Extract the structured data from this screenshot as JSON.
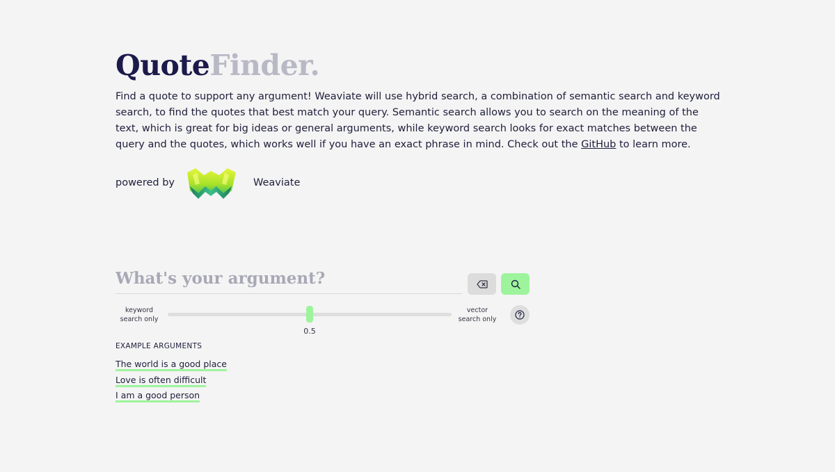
{
  "header": {
    "title_part1": "Quote",
    "title_part2": "Finder."
  },
  "description": {
    "text_before_link": "Find a quote to support any argument! Weaviate will use hybrid search, a combination of semantic search and keyword search, to find the quotes that best match your query. Semantic search allows you to search on the meaning of the text, which is great for big ideas or general arguments, while keyword search looks for exact matches between the query and the quotes, which works well if you have an exact phrase in mind. Check out the ",
    "link_text": "GitHub",
    "text_after_link": " to learn more."
  },
  "powered_by": {
    "label": "powered by",
    "name": "Weaviate",
    "logo_icon": "weaviate-logo"
  },
  "search": {
    "placeholder": "What's your argument?",
    "value": "",
    "clear_icon": "backspace-icon",
    "search_icon": "search-icon"
  },
  "slider": {
    "left_label_line1": "keyword",
    "left_label_line2": "search only",
    "right_label_line1": "vector",
    "right_label_line2": "search only",
    "value": 0.5,
    "value_label": "0.5",
    "help_icon": "question-icon"
  },
  "examples": {
    "heading": "EXAMPLE ARGUMENTS",
    "items": [
      "The world is a good place",
      "Love is often difficult",
      "I am a good person"
    ]
  },
  "colors": {
    "accent": "#9ef49c",
    "title_dark": "#1b1a4a",
    "title_light": "#b9b9c6",
    "background": "#f4f4f4"
  }
}
